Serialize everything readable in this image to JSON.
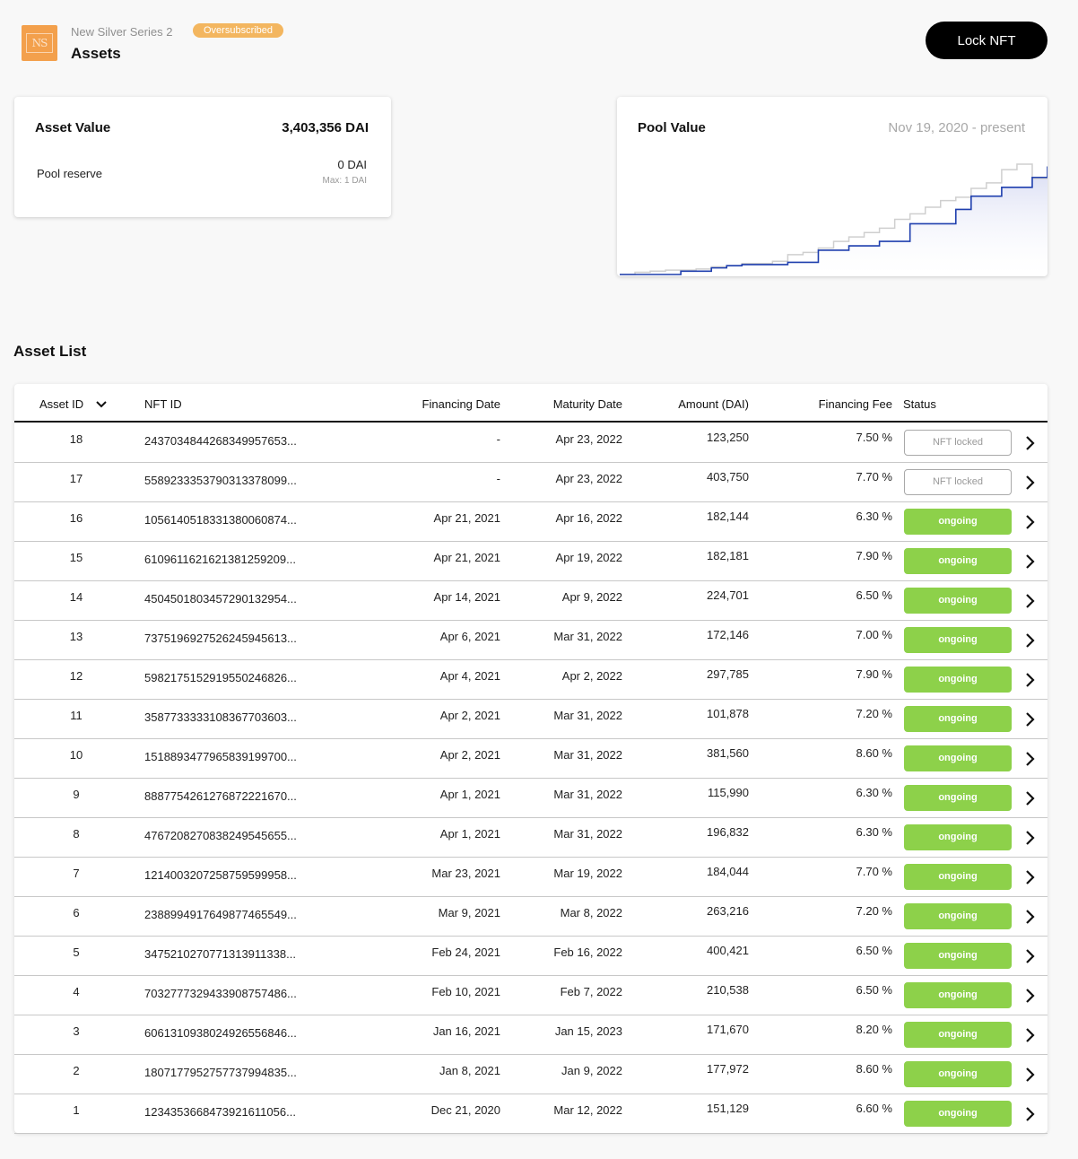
{
  "header": {
    "pool_name": "New Silver Series 2",
    "badge": "Oversubscribed",
    "title": "Assets",
    "lock_button": "Lock NFT",
    "logo_text": "NS"
  },
  "asset_card": {
    "title": "Asset Value",
    "value": "3,403,356 DAI",
    "reserve_label": "Pool reserve",
    "reserve_value": "0 DAI",
    "reserve_max": "Max: 1 DAI"
  },
  "pool_card": {
    "title": "Pool Value",
    "range": "Nov 19, 2020 - present"
  },
  "chart_data": {
    "type": "area",
    "title": "Pool Value",
    "subtitle": "Nov 19, 2020 - present",
    "xlim": [
      "2020-11-19",
      "2021-04-23"
    ],
    "colors": {
      "asset_value": "#1f3fae",
      "pool_value": "#cfcfcf",
      "fill": "#d8dcf3"
    },
    "series": [
      {
        "key": "asset_value",
        "values": [
          0,
          0,
          0,
          0,
          0.03,
          0.03,
          0.06,
          0.08,
          0.09,
          0.09,
          0.09,
          0.11,
          0.11,
          0.22,
          0.22,
          0.26,
          0.26,
          0.3,
          0.3,
          0.46,
          0.46,
          0.46,
          0.59,
          0.71,
          0.71,
          0.79,
          0.79,
          0.88,
          0.98
        ]
      },
      {
        "key": "pool_value",
        "values": [
          0,
          0.02,
          0.03,
          0.04,
          0.04,
          0.05,
          0.07,
          0.08,
          0.1,
          0.1,
          0.12,
          0.18,
          0.2,
          0.24,
          0.3,
          0.34,
          0.38,
          0.42,
          0.5,
          0.55,
          0.61,
          0.67,
          0.7,
          0.78,
          0.83,
          0.95,
          1.0,
          0.87,
          0.98
        ]
      }
    ]
  },
  "section_title": "Asset List",
  "table": {
    "headers": {
      "asset_id": "Asset ID",
      "nft_id": "NFT ID",
      "financing_date": "Financing Date",
      "maturity_date": "Maturity Date",
      "amount": "Amount (DAI)",
      "fee": "Financing Fee",
      "status": "Status"
    },
    "rows": [
      {
        "id": "18",
        "nft": "2437034844268349957653...",
        "fin": "-",
        "mat": "Apr 23, 2022",
        "amt": "123,250",
        "fee": "7.50 %",
        "status": "NFT locked",
        "kind": "locked"
      },
      {
        "id": "17",
        "nft": "5589233353790313378099...",
        "fin": "-",
        "mat": "Apr 23, 2022",
        "amt": "403,750",
        "fee": "7.70 %",
        "status": "NFT locked",
        "kind": "locked"
      },
      {
        "id": "16",
        "nft": "1056140518331380060874...",
        "fin": "Apr 21, 2021",
        "mat": "Apr 16, 2022",
        "amt": "182,144",
        "fee": "6.30 %",
        "status": "ongoing",
        "kind": "ongoing"
      },
      {
        "id": "15",
        "nft": "6109611621621381259209...",
        "fin": "Apr 21, 2021",
        "mat": "Apr 19, 2022",
        "amt": "182,181",
        "fee": "7.90 %",
        "status": "ongoing",
        "kind": "ongoing"
      },
      {
        "id": "14",
        "nft": "4504501803457290132954...",
        "fin": "Apr 14, 2021",
        "mat": "Apr 9, 2022",
        "amt": "224,701",
        "fee": "6.50 %",
        "status": "ongoing",
        "kind": "ongoing"
      },
      {
        "id": "13",
        "nft": "7375196927526245945613...",
        "fin": "Apr 6, 2021",
        "mat": "Mar 31, 2022",
        "amt": "172,146",
        "fee": "7.00 %",
        "status": "ongoing",
        "kind": "ongoing"
      },
      {
        "id": "12",
        "nft": "5982175152919550246826...",
        "fin": "Apr 4, 2021",
        "mat": "Apr 2, 2022",
        "amt": "297,785",
        "fee": "7.90 %",
        "status": "ongoing",
        "kind": "ongoing"
      },
      {
        "id": "11",
        "nft": "3587733333108367703603...",
        "fin": "Apr 2, 2021",
        "mat": "Mar 31, 2022",
        "amt": "101,878",
        "fee": "7.20 %",
        "status": "ongoing",
        "kind": "ongoing"
      },
      {
        "id": "10",
        "nft": "1518893477965839199700...",
        "fin": "Apr 2, 2021",
        "mat": "Mar 31, 2022",
        "amt": "381,560",
        "fee": "8.60 %",
        "status": "ongoing",
        "kind": "ongoing"
      },
      {
        "id": "9",
        "nft": "8887754261276872221670...",
        "fin": "Apr 1, 2021",
        "mat": "Mar 31, 2022",
        "amt": "115,990",
        "fee": "6.30 %",
        "status": "ongoing",
        "kind": "ongoing"
      },
      {
        "id": "8",
        "nft": "4767208270838249545655...",
        "fin": "Apr 1, 2021",
        "mat": "Mar 31, 2022",
        "amt": "196,832",
        "fee": "6.30 %",
        "status": "ongoing",
        "kind": "ongoing"
      },
      {
        "id": "7",
        "nft": "1214003207258759599958...",
        "fin": "Mar 23, 2021",
        "mat": "Mar 19, 2022",
        "amt": "184,044",
        "fee": "7.70 %",
        "status": "ongoing",
        "kind": "ongoing"
      },
      {
        "id": "6",
        "nft": "2388994917649877465549...",
        "fin": "Mar 9, 2021",
        "mat": "Mar 8, 2022",
        "amt": "263,216",
        "fee": "7.20 %",
        "status": "ongoing",
        "kind": "ongoing"
      },
      {
        "id": "5",
        "nft": "3475210270771313911338...",
        "fin": "Feb 24, 2021",
        "mat": "Feb 16, 2022",
        "amt": "400,421",
        "fee": "6.50 %",
        "status": "ongoing",
        "kind": "ongoing"
      },
      {
        "id": "4",
        "nft": "7032777329433908757486...",
        "fin": "Feb 10, 2021",
        "mat": "Feb 7, 2022",
        "amt": "210,538",
        "fee": "6.50 %",
        "status": "ongoing",
        "kind": "ongoing"
      },
      {
        "id": "3",
        "nft": "6061310938024926556846...",
        "fin": "Jan 16, 2021",
        "mat": "Jan 15, 2023",
        "amt": "171,670",
        "fee": "8.20 %",
        "status": "ongoing",
        "kind": "ongoing"
      },
      {
        "id": "2",
        "nft": "1807177952757737994835...",
        "fin": "Jan 8, 2021",
        "mat": "Jan 9, 2022",
        "amt": "177,972",
        "fee": "8.60 %",
        "status": "ongoing",
        "kind": "ongoing"
      },
      {
        "id": "1",
        "nft": "1234353668473921611056...",
        "fin": "Dec 21, 2020",
        "mat": "Mar 12, 2022",
        "amt": "151,129",
        "fee": "6.60 %",
        "status": "ongoing",
        "kind": "ongoing"
      }
    ]
  },
  "icons": {
    "sort": "chevron-down-icon",
    "row_link": "chevron-right-icon"
  }
}
